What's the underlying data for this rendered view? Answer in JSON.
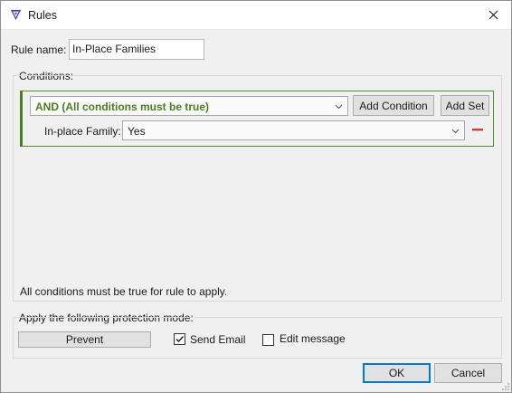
{
  "window": {
    "title": "Rules",
    "icon": "app-logo-icon",
    "close_icon": "close-icon"
  },
  "rule": {
    "name_label": "Rule name:",
    "name_value": "In-Place Families"
  },
  "conditions": {
    "section_label": "Conditions:",
    "logic_value": "AND (All conditions must be true)",
    "logic_color": "#4b7d23",
    "add_condition_label": "Add Condition",
    "add_set_label": "Add Set",
    "items": [
      {
        "label": "In-place Family:",
        "value": "Yes"
      }
    ],
    "footer_note": "All conditions must be true for rule to apply."
  },
  "protection": {
    "section_label": "Apply the following protection mode:",
    "mode_label": "Prevent",
    "send_email_label": "Send Email",
    "send_email_checked": true,
    "edit_message_label": "Edit message",
    "edit_message_checked": false
  },
  "footer": {
    "ok_label": "OK",
    "cancel_label": "Cancel"
  },
  "colors": {
    "accent": "#0078d7",
    "remove": "#d83b3b"
  }
}
